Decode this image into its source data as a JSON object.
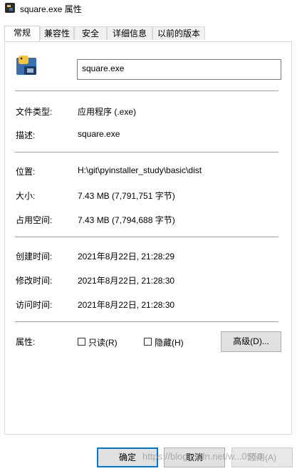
{
  "window": {
    "title": "square.exe 属性"
  },
  "tabs": [
    {
      "label": "常规",
      "active": true
    },
    {
      "label": "兼容性"
    },
    {
      "label": "安全"
    },
    {
      "label": "详细信息"
    },
    {
      "label": "以前的版本"
    }
  ],
  "general": {
    "file_name": "square.exe",
    "file_type": {
      "label": "文件类型:",
      "value": "应用程序 (.exe)"
    },
    "description": {
      "label": "描述:",
      "value": "square.exe"
    },
    "location": {
      "label": "位置:",
      "value": "H:\\git\\pyinstaller_study\\basic\\dist"
    },
    "size": {
      "label": "大小:",
      "value": "7.43 MB (7,791,751 字节)"
    },
    "size_on_disk": {
      "label": "占用空间:",
      "value": "7.43 MB (7,794,688 字节)"
    },
    "created": {
      "label": "创建时间:",
      "value": "2021年8月22日, 21:28:29"
    },
    "modified": {
      "label": "修改时间:",
      "value": "2021年8月22日, 21:28:30"
    },
    "accessed": {
      "label": "访问时间:",
      "value": "2021年8月22日, 21:28:30"
    },
    "attributes": {
      "label": "属性:",
      "readonly_label": "只读(R)",
      "hidden_label": "隐藏(H)",
      "advanced_label": "高级(D)..."
    }
  },
  "buttons": {
    "ok": "确定",
    "cancel": "取消",
    "apply": "应用(A)"
  },
  "watermark": "https://blog.csdn.net/w...0550",
  "colors": {
    "accent": "#0078d7",
    "icon_blue": "#3a6fb0",
    "icon_yellow": "#f2c53d"
  },
  "icons": {
    "title": "python-exe-icon",
    "file": "python-exe-icon"
  }
}
